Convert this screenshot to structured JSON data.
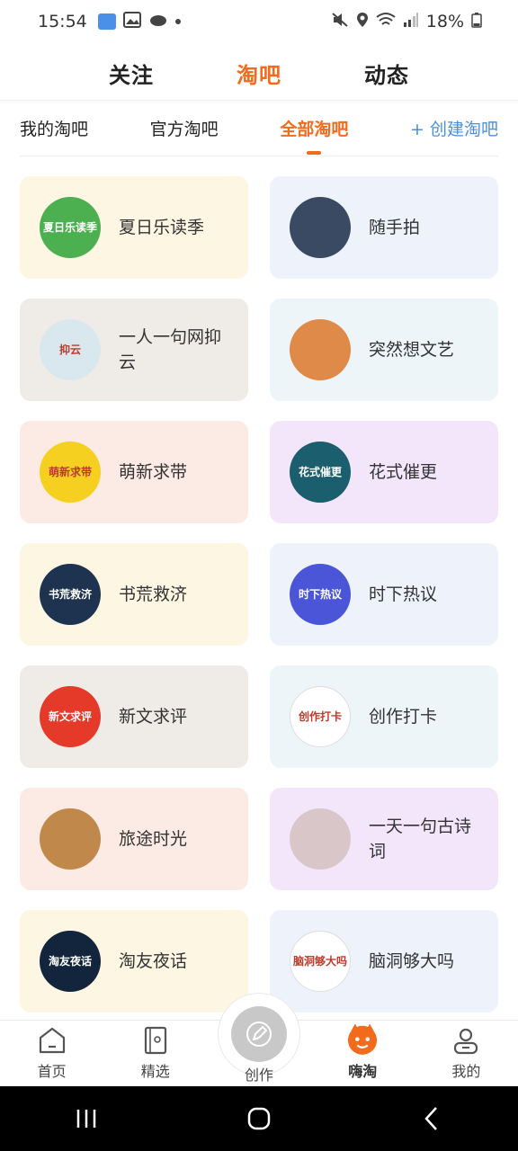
{
  "status_bar": {
    "time": "15:54",
    "battery": "18%"
  },
  "top_tabs": [
    {
      "label": "关注",
      "active": false
    },
    {
      "label": "淘吧",
      "active": true
    },
    {
      "label": "动态",
      "active": false
    }
  ],
  "sub_tabs": [
    {
      "label": "我的淘吧"
    },
    {
      "label": "官方淘吧"
    },
    {
      "label": "全部淘吧"
    },
    {
      "label": "+ 创建淘吧"
    }
  ],
  "cards": [
    {
      "label": "夏日乐读季",
      "bg": "#fdf6e3",
      "avatar_text": "夏日乐读季",
      "avatar_bg": "#4caf50"
    },
    {
      "label": "随手拍",
      "bg": "#eef2fb",
      "avatar_text": "",
      "avatar_bg": "#3a4a63"
    },
    {
      "label": "一人一句网抑云",
      "bg": "#efece8",
      "avatar_text": "抑云",
      "avatar_bg": "#d9e8ef"
    },
    {
      "label": "突然想文艺",
      "bg": "#eef5f9",
      "avatar_text": "",
      "avatar_bg": "#e08a4a"
    },
    {
      "label": "萌新求带",
      "bg": "#fcebe4",
      "avatar_text": "萌新求带",
      "avatar_bg": "#f5d020"
    },
    {
      "label": "花式催更",
      "bg": "#f3e6fb",
      "avatar_text": "花式催更",
      "avatar_bg": "#1b5e6e"
    },
    {
      "label": "书荒救济",
      "bg": "#fdf6e3",
      "avatar_text": "书荒救济",
      "avatar_bg": "#1e3350"
    },
    {
      "label": "时下热议",
      "bg": "#eef2fb",
      "avatar_text": "时下热议",
      "avatar_bg": "#4a55d8"
    },
    {
      "label": "新文求评",
      "bg": "#efece8",
      "avatar_text": "新文求评",
      "avatar_bg": "#e53a2a"
    },
    {
      "label": "创作打卡",
      "bg": "#eef5f9",
      "avatar_text": "创作打卡",
      "avatar_bg": "#ffffff"
    },
    {
      "label": "旅途时光",
      "bg": "#fcebe4",
      "avatar_text": "",
      "avatar_bg": "#c0884a"
    },
    {
      "label": "一天一句古诗词",
      "bg": "#f3e6fb",
      "avatar_text": "",
      "avatar_bg": "#d9c6c8"
    },
    {
      "label": "淘友夜话",
      "bg": "#fdf6e3",
      "avatar_text": "淘友夜话",
      "avatar_bg": "#13253d"
    },
    {
      "label": "脑洞够大吗",
      "bg": "#eef2fb",
      "avatar_text": "脑洞够大吗",
      "avatar_bg": "#ffffff"
    }
  ],
  "bottom_nav": [
    {
      "label": "首页",
      "icon": "home-icon"
    },
    {
      "label": "精选",
      "icon": "book-icon"
    },
    {
      "label": "创作",
      "icon": "pen-icon"
    },
    {
      "label": "嗨淘",
      "icon": "mascot-icon"
    },
    {
      "label": "我的",
      "icon": "profile-icon"
    }
  ],
  "colors": {
    "accent": "#f26b1d",
    "link": "#4a90d9"
  }
}
